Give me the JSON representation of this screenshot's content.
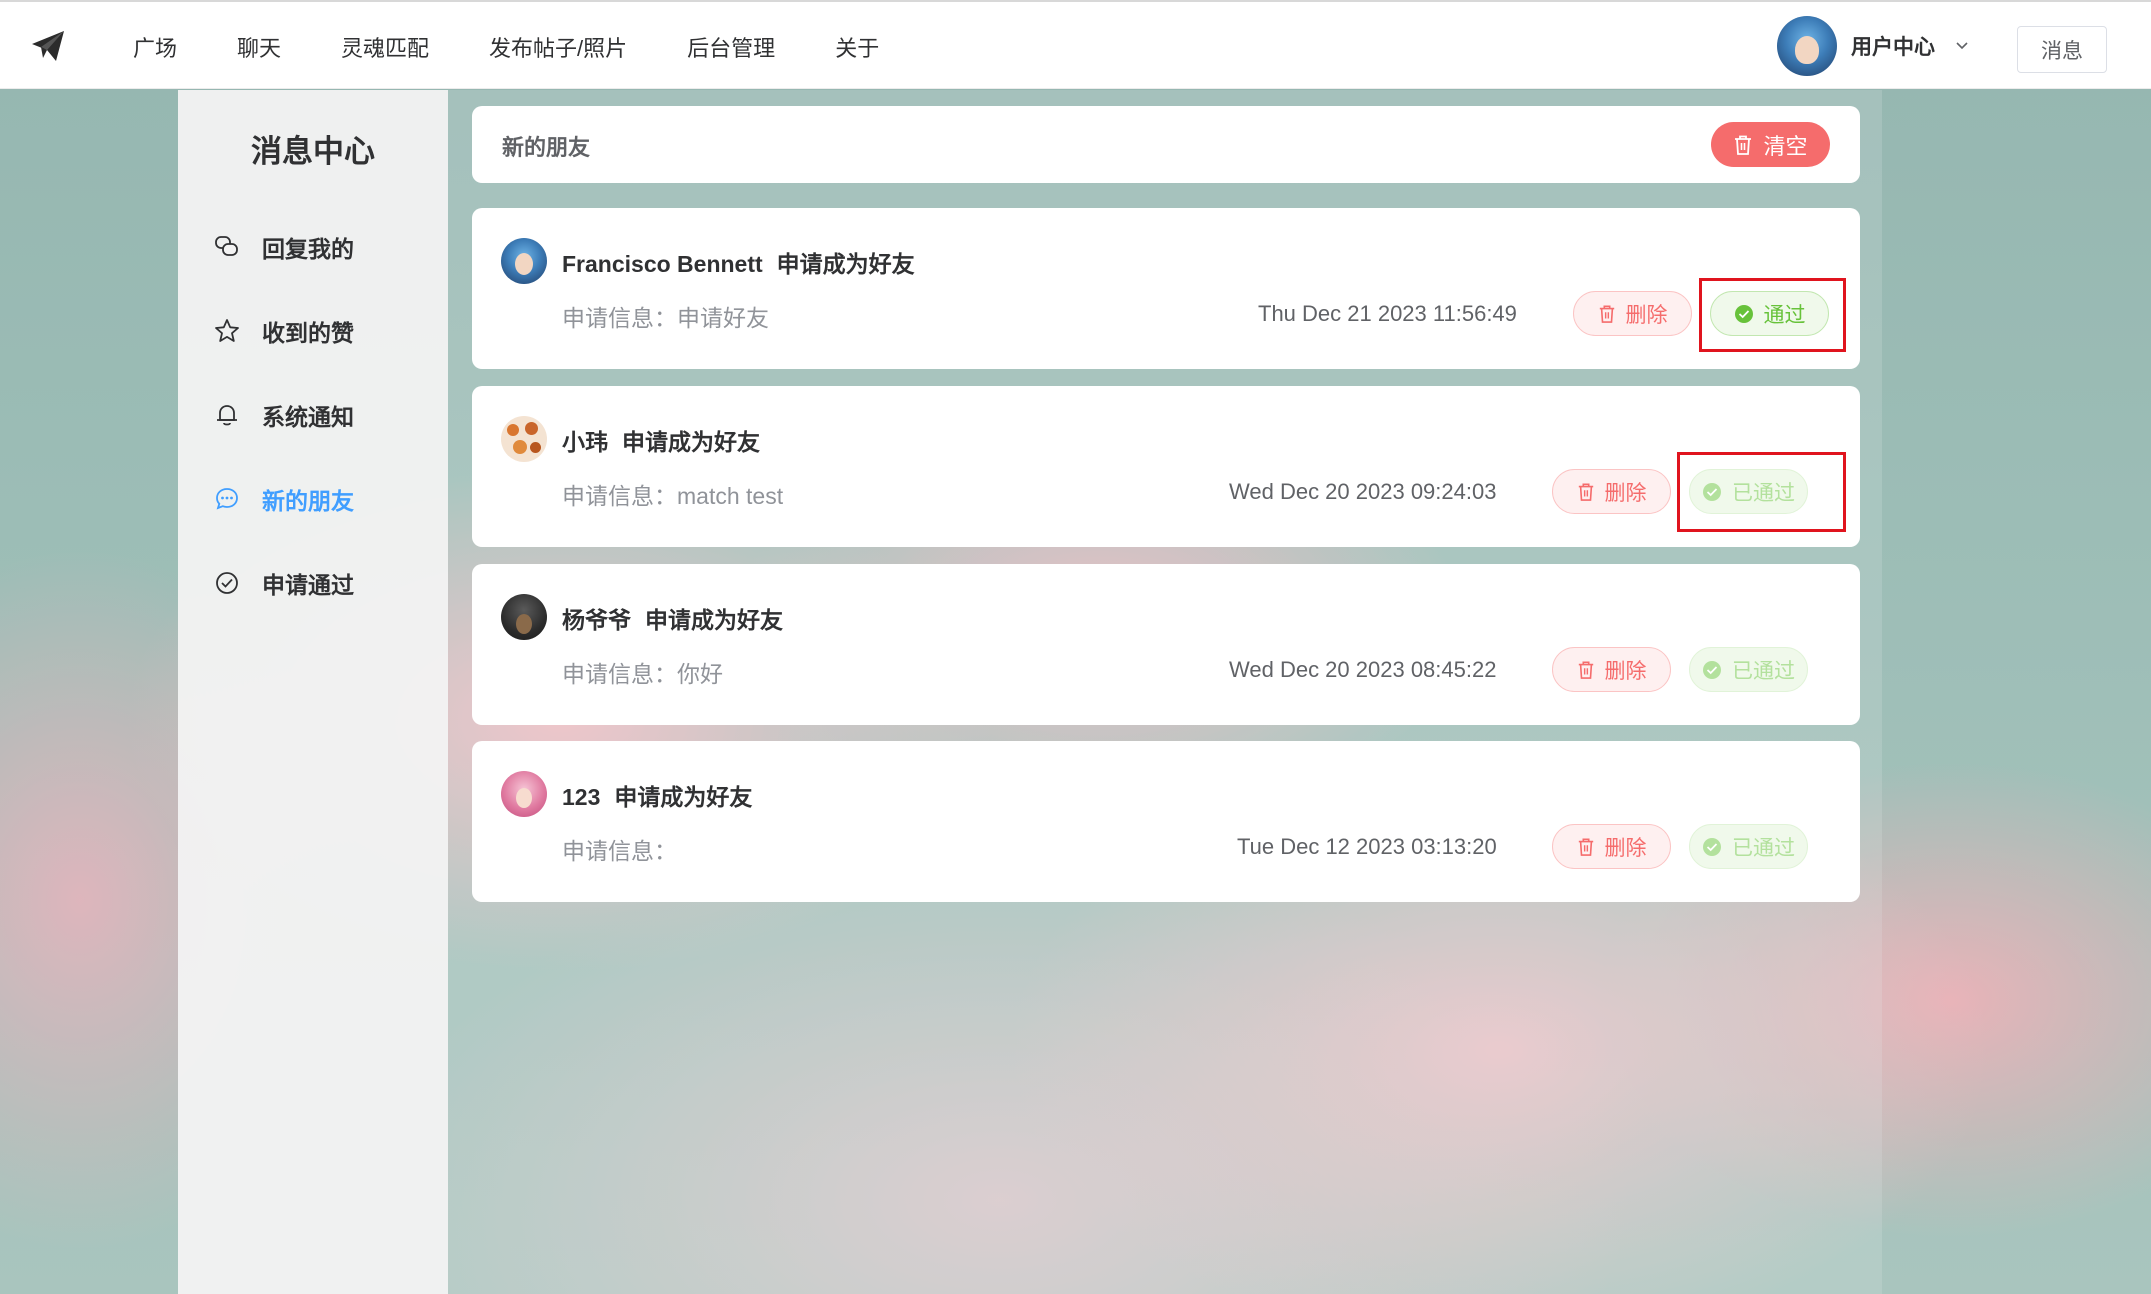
{
  "nav": {
    "items": [
      "广场",
      "聊天",
      "灵魂匹配",
      "发布帖子/照片",
      "后台管理",
      "关于"
    ],
    "user_label": "用户中心",
    "message_button": "消息"
  },
  "sidebar": {
    "title": "消息中心",
    "items": [
      {
        "label": "回复我的",
        "icon": "chat-bubbles-icon"
      },
      {
        "label": "收到的赞",
        "icon": "star-icon"
      },
      {
        "label": "系统通知",
        "icon": "bell-icon"
      },
      {
        "label": "新的朋友",
        "icon": "message-dots-icon",
        "active": true
      },
      {
        "label": "申请通过",
        "icon": "check-circle-icon"
      }
    ]
  },
  "header": {
    "title": "新的朋友",
    "clear_button": "清空"
  },
  "requests": [
    {
      "name": "Francisco Bennett",
      "action": "申请成为好友",
      "info": "申请信息：申请好友",
      "time": "Thu Dec 21 2023 11:56:49",
      "delete_label": "删除",
      "status_label": "通过",
      "status": "pending"
    },
    {
      "name": "小玮",
      "action": "申请成为好友",
      "info": "申请信息：match test",
      "time": "Wed Dec 20 2023 09:24:03",
      "delete_label": "删除",
      "status_label": "已通过",
      "status": "approved"
    },
    {
      "name": "杨爷爷",
      "action": "申请成为好友",
      "info": "申请信息：你好",
      "time": "Wed Dec 20 2023 08:45:22",
      "delete_label": "删除",
      "status_label": "已通过",
      "status": "approved"
    },
    {
      "name": "123",
      "action": "申请成为好友",
      "info": "申请信息：",
      "time": "Tue Dec 12 2023 03:13:20",
      "delete_label": "删除",
      "status_label": "已通过",
      "status": "approved"
    }
  ],
  "colors": {
    "accent": "#409eff",
    "danger": "#f56c6c",
    "success": "#67c23a",
    "highlight": "#e0141e"
  }
}
